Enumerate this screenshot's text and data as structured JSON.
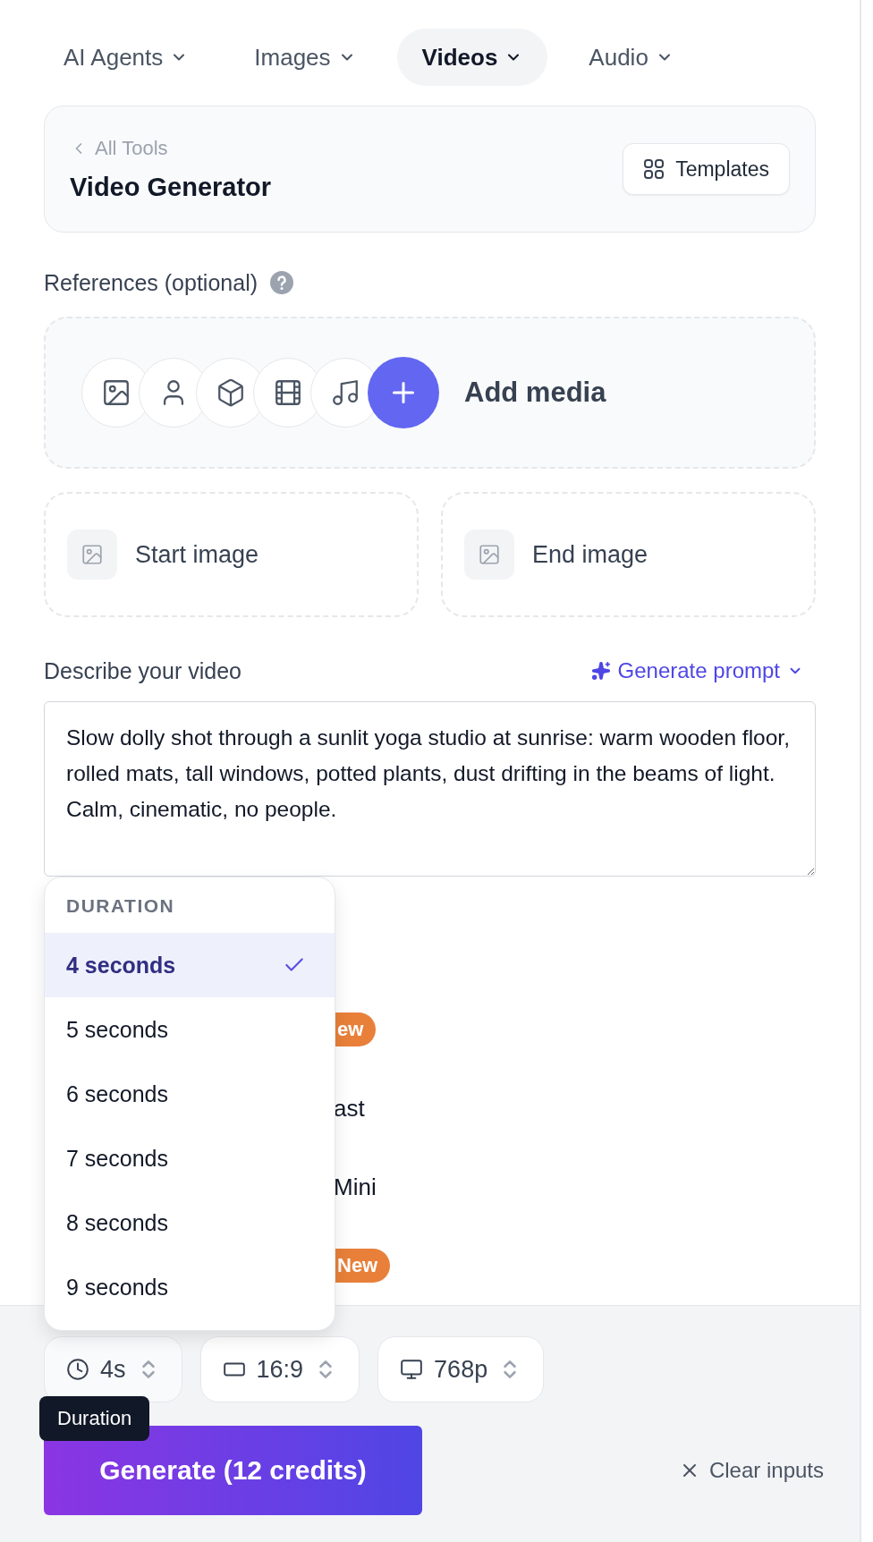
{
  "nav_tabs": [
    {
      "label": "AI Agents",
      "selected": false
    },
    {
      "label": "Images",
      "selected": false
    },
    {
      "label": "Videos",
      "selected": true
    },
    {
      "label": "Audio",
      "selected": false
    }
  ],
  "tool_header": {
    "back_link": "All Tools",
    "title": "Video Generator",
    "templates_button": "Templates"
  },
  "references": {
    "label": "References (optional)",
    "add_media": "Add media"
  },
  "frame_slots": [
    {
      "label": "Start image"
    },
    {
      "label": "End image"
    }
  ],
  "prompt": {
    "label": "Describe your video",
    "generate_prompt": "Generate prompt",
    "value": "Slow dolly shot through a sunlit yoga studio at sunrise: warm wooden floor, rolled mats, tall windows, potted plants, dust drifting in the beams of light. Calm, cinematic, no people."
  },
  "model_rows": [
    {
      "kind": "badge",
      "text": "ew"
    },
    {
      "kind": "text",
      "text": "ast"
    },
    {
      "kind": "text",
      "text": "Mini"
    },
    {
      "kind": "badge",
      "text": "New"
    }
  ],
  "duration_menu": {
    "heading": "DURATION",
    "options": [
      {
        "label": "4 seconds",
        "selected": true
      },
      {
        "label": "5 seconds",
        "selected": false
      },
      {
        "label": "6 seconds",
        "selected": false
      },
      {
        "label": "7 seconds",
        "selected": false
      },
      {
        "label": "8 seconds",
        "selected": false
      },
      {
        "label": "9 seconds",
        "selected": false
      }
    ]
  },
  "settings": [
    {
      "kind": "duration",
      "value": "4s"
    },
    {
      "kind": "aspect",
      "value": "16:9"
    },
    {
      "kind": "resolution",
      "value": "768p"
    }
  ],
  "tooltip": "Duration",
  "generate_button": "Generate (12 credits)",
  "clear_button": "Clear inputs"
}
